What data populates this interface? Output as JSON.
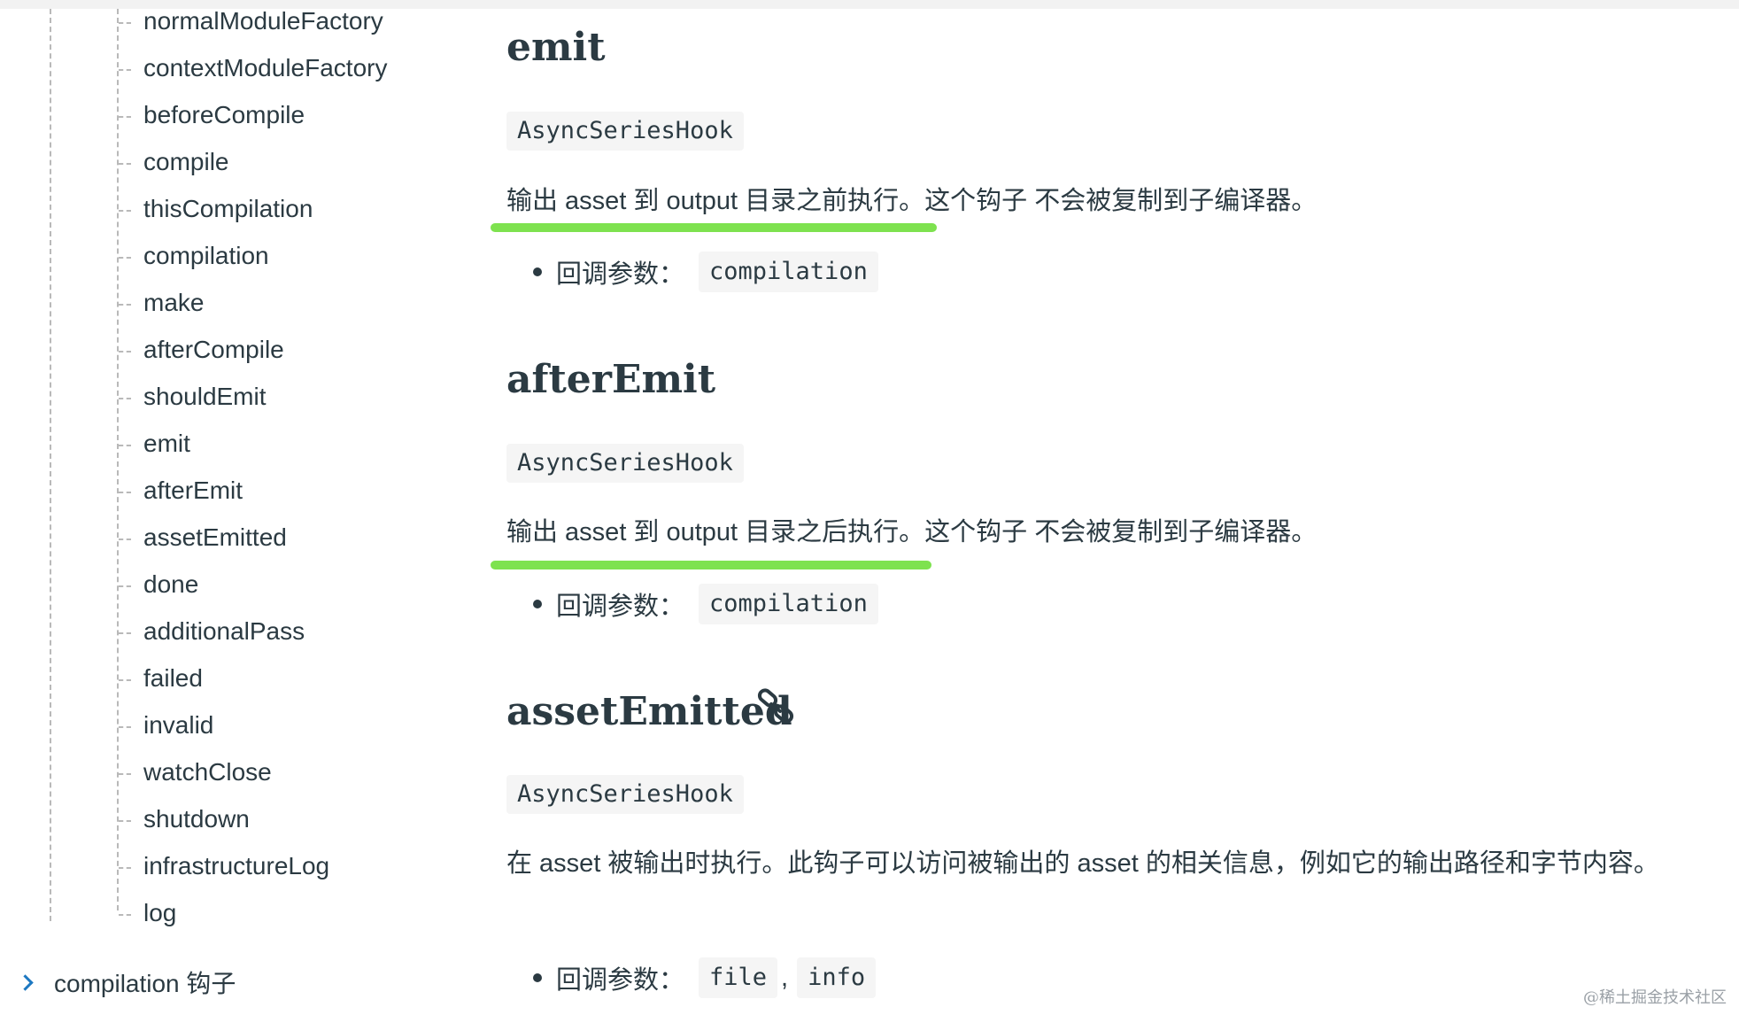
{
  "sidebar": {
    "items": [
      {
        "label": "normalModuleFactory"
      },
      {
        "label": "contextModuleFactory"
      },
      {
        "label": "beforeCompile"
      },
      {
        "label": "compile"
      },
      {
        "label": "thisCompilation"
      },
      {
        "label": "compilation"
      },
      {
        "label": "make"
      },
      {
        "label": "afterCompile"
      },
      {
        "label": "shouldEmit"
      },
      {
        "label": "emit"
      },
      {
        "label": "afterEmit"
      },
      {
        "label": "assetEmitted"
      },
      {
        "label": "done"
      },
      {
        "label": "additionalPass"
      },
      {
        "label": "failed"
      },
      {
        "label": "invalid"
      },
      {
        "label": "watchClose"
      },
      {
        "label": "shutdown"
      },
      {
        "label": "infrastructureLog"
      },
      {
        "label": "log"
      }
    ],
    "collapsed_section": "compilation 钩子"
  },
  "sections": [
    {
      "title": "emit",
      "hook_type": "AsyncSeriesHook",
      "description": "输出 asset 到 output 目录之前执行。这个钩子 不会被复制到子编译器。",
      "params_label": "回调参数：",
      "params": [
        "compilation"
      ]
    },
    {
      "title": "afterEmit",
      "hook_type": "AsyncSeriesHook",
      "description": "输出 asset 到 output 目录之后执行。这个钩子 不会被复制到子编译器。",
      "params_label": "回调参数：",
      "params": [
        "compilation"
      ]
    },
    {
      "title": "assetEmitted",
      "hook_type": "AsyncSeriesHook",
      "description": "在 asset 被输出时执行。此钩子可以访问被输出的 asset 的相关信息，例如它的输出路径和字节内容。",
      "params_label": "回调参数：",
      "params": [
        "file",
        "info"
      ],
      "param_separator": ","
    }
  ],
  "icons": {
    "anchor": "link-icon",
    "collapse": "chevron-right-icon"
  },
  "colors": {
    "highlight": "#7ee24f",
    "chevron": "#1d78c1"
  },
  "watermark": "@稀土掘金技术社区"
}
